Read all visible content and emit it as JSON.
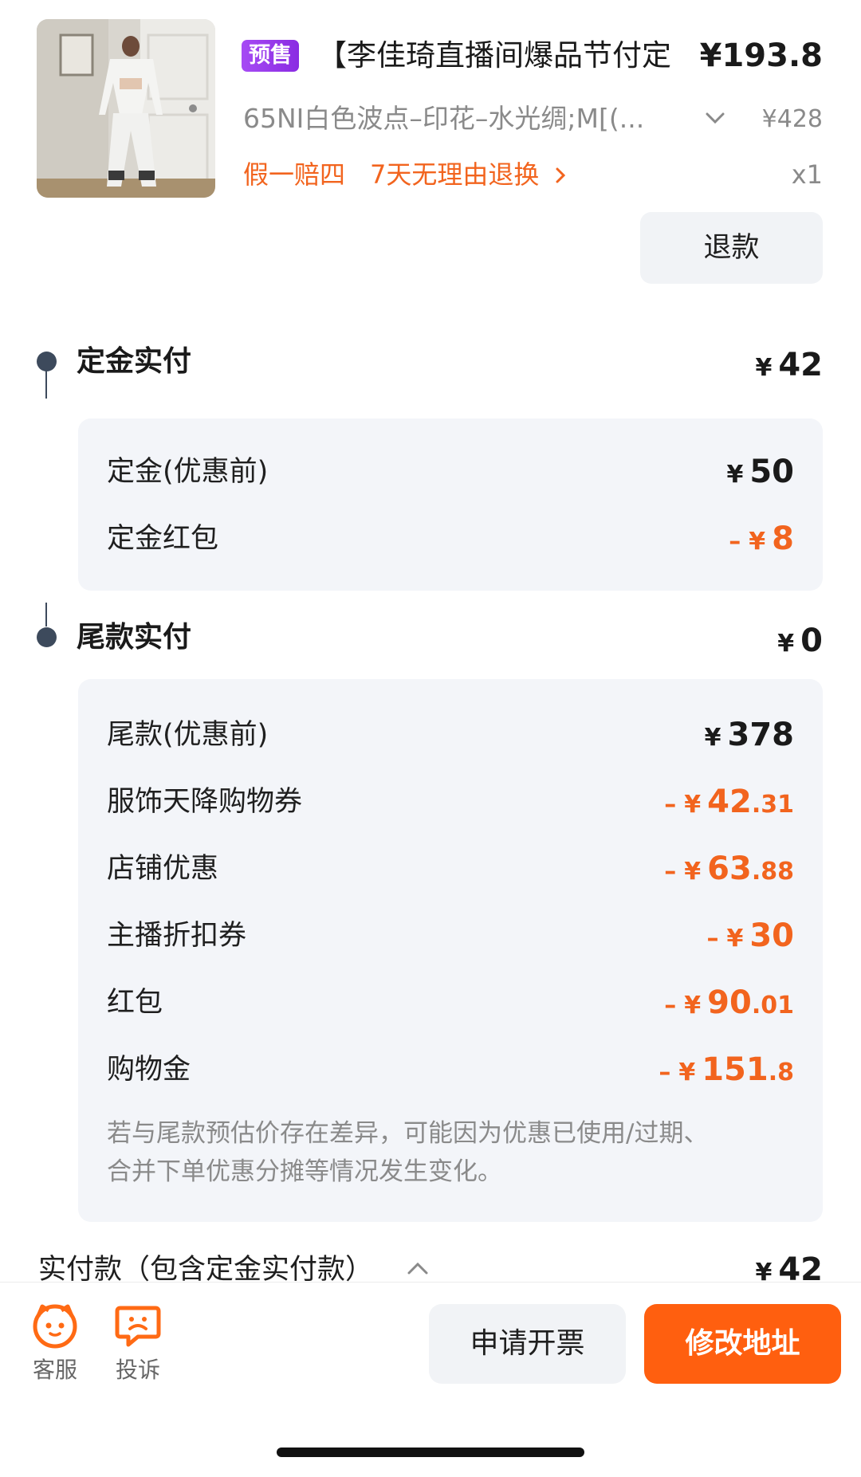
{
  "product": {
    "badge": "预售",
    "title": "【李佳琦直播间爆品节付定",
    "price": "¥193.8",
    "sku": "65NI白色波点–印花–水光绸;M[(...",
    "original_price": "¥428",
    "guarantee": "假一赔四",
    "return_policy": "7天无理由退换",
    "quantity": "x1",
    "refund_label": "退款"
  },
  "deposit": {
    "title": "定金实付",
    "yen": "¥",
    "amount": "42",
    "rows": [
      {
        "label": "定金(优惠前)",
        "minus": "",
        "yen": "¥",
        "int": "50",
        "cents": ""
      },
      {
        "label": "定金红包",
        "minus": "–",
        "yen": "¥",
        "int": "8",
        "cents": ""
      }
    ]
  },
  "balance": {
    "title": "尾款实付",
    "yen": "¥",
    "amount": "0",
    "rows": [
      {
        "label": "尾款(优惠前)",
        "minus": "",
        "yen": "¥",
        "int": "378",
        "cents": ""
      },
      {
        "label": "服饰天降购物券",
        "minus": "–",
        "yen": "¥",
        "int": "42",
        "cents": ".31"
      },
      {
        "label": "店铺优惠",
        "minus": "–",
        "yen": "¥",
        "int": "63",
        "cents": ".88"
      },
      {
        "label": "主播折扣券",
        "minus": "–",
        "yen": "¥",
        "int": "30",
        "cents": ""
      },
      {
        "label": "红包",
        "minus": "–",
        "yen": "¥",
        "int": "90",
        "cents": ".01"
      },
      {
        "label": "购物金",
        "minus": "–",
        "yen": "¥",
        "int": "151",
        "cents": ".8"
      }
    ],
    "note_line1": "若与尾款预估价存在差异，可能因为优惠已使用/过期、",
    "note_line2": "合并下单优惠分摊等情况发生变化。"
  },
  "total": {
    "label": "实付款（包含定金实付款）",
    "yen": "¥",
    "amount": "42"
  },
  "bottom_bar": {
    "service_label": "客服",
    "complaint_label": "投诉",
    "invoice_label": "申请开票",
    "address_label": "修改地址"
  },
  "icons": {
    "service": "customer-service-face-icon",
    "complaint": "complaint-chat-icon"
  },
  "colors": {
    "accent_orange": "#ff5f0f",
    "discount_orange": "#f2641e",
    "presale_purple": "#9b3ef0",
    "card_bg": "#f3f5f9",
    "timeline": "#3d4a5c"
  }
}
